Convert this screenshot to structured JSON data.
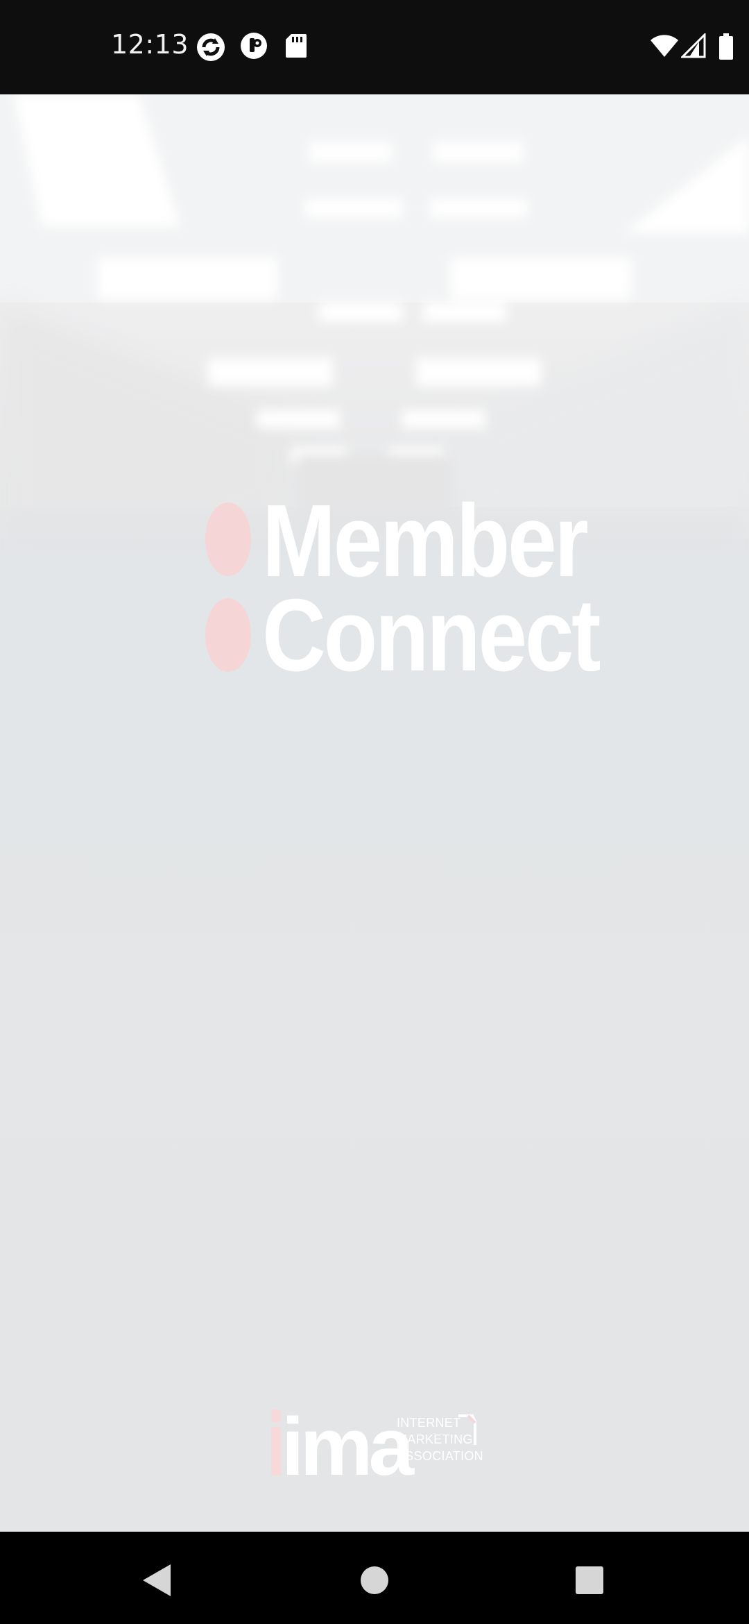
{
  "status_bar": {
    "time": "12:13",
    "left_icons": [
      "sync-icon",
      "app-notification-icon",
      "sd-card-icon"
    ],
    "right_icons": [
      "wifi-icon",
      "cell-signal-icon",
      "battery-icon"
    ]
  },
  "splash": {
    "logo_line1": "Member",
    "logo_line2": "Connect",
    "footer_logo": {
      "letters": "ima",
      "line1": "INTERNET",
      "line2": "MARKETING",
      "line3": "ASSOCIATION"
    },
    "accent_color": "#f6d5d6",
    "background_color": "#e6e8ea"
  },
  "nav_bar": {
    "buttons": [
      "back-icon",
      "home-icon",
      "recents-icon"
    ]
  }
}
